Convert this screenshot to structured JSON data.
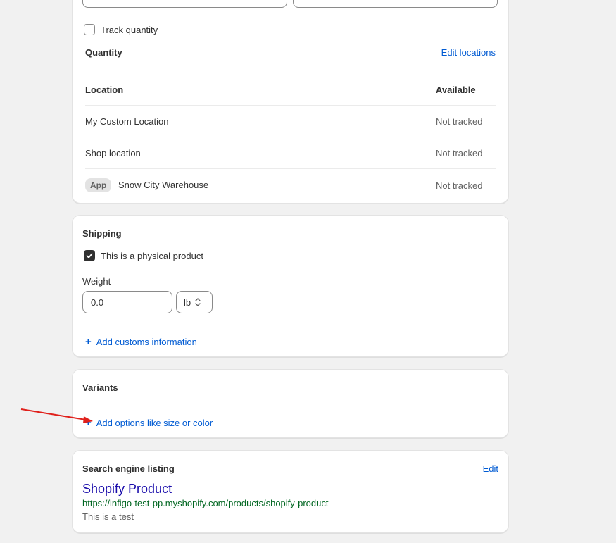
{
  "inventory": {
    "track_quantity_label": "Track quantity",
    "track_quantity_checked": false,
    "quantity_heading": "Quantity",
    "edit_locations_link": "Edit locations",
    "table": {
      "headers": [
        "Location",
        "Available"
      ],
      "rows": [
        {
          "badge": "",
          "location": "My Custom Location",
          "available": "Not tracked"
        },
        {
          "badge": "",
          "location": "Shop location",
          "available": "Not tracked"
        },
        {
          "badge": "App",
          "location": "Snow City Warehouse",
          "available": "Not tracked"
        }
      ]
    }
  },
  "shipping": {
    "heading": "Shipping",
    "physical_label": "This is a physical product",
    "physical_checked": true,
    "weight_label": "Weight",
    "weight_value": "0.0",
    "weight_unit": "lb",
    "customs_link": "Add customs information"
  },
  "variants": {
    "heading": "Variants",
    "add_options_link": "Add options like size or color"
  },
  "seo": {
    "heading": "Search engine listing",
    "edit_link": "Edit",
    "title": "Shopify Product",
    "url": "https://infigo-test-pp.myshopify.com/products/shopify-product",
    "description": "This is a test"
  },
  "colors": {
    "link": "#005bd3",
    "seo_title": "#1a0dab",
    "seo_url": "#006621",
    "annotation_arrow": "#e0201b"
  }
}
